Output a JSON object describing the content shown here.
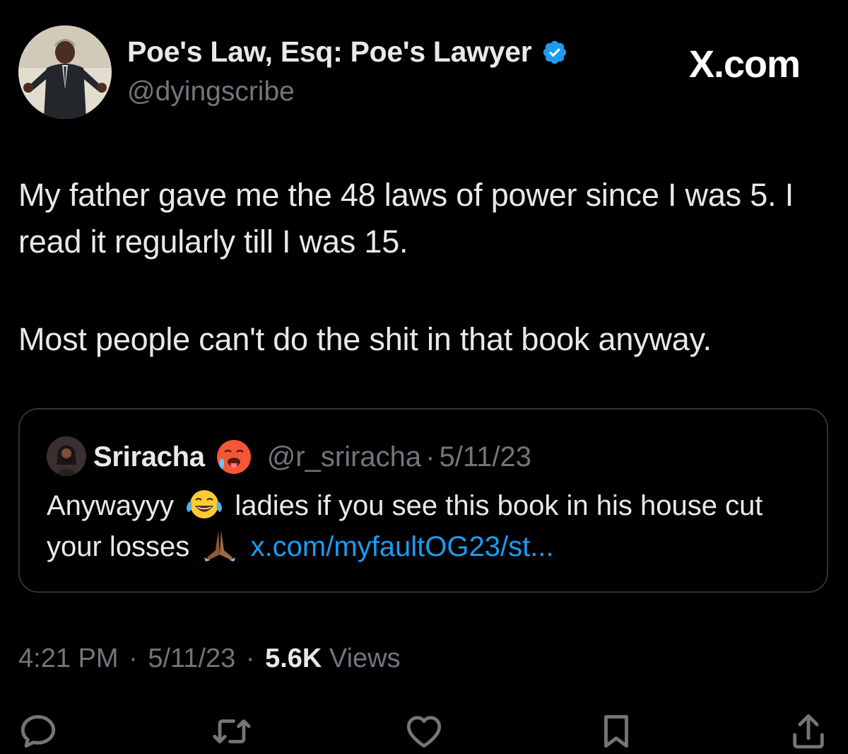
{
  "author": {
    "display_name": "Poe's Law, Esq: Poe's Lawyer",
    "handle": "@dyingscribe",
    "verified": true
  },
  "watermark": "X.com",
  "tweet": {
    "paragraphs": [
      "My father gave me the 48 laws of power since I was 5. I read it regularly till I was 15.",
      "Most people can't do the shit in that book anyway."
    ]
  },
  "quoted_tweet": {
    "display_name": "Sriracha",
    "name_emoji": "hot-face-icon",
    "handle": "@r_sriracha",
    "separator": "·",
    "date": "5/11/23",
    "text_part1": "Anywayyy",
    "text_part2": "ladies if you see this book in his house cut your losses",
    "link": "x.com/myfaultOG23/st..."
  },
  "meta": {
    "time": "4:21 PM",
    "separator": "·",
    "date": "5/11/23",
    "views_count": "5.6K",
    "views_label": "Views"
  },
  "actions": [
    {
      "name": "reply-icon"
    },
    {
      "name": "retweet-icon"
    },
    {
      "name": "like-icon"
    },
    {
      "name": "bookmark-icon"
    },
    {
      "name": "share-icon"
    }
  ],
  "colors": {
    "background": "#000000",
    "text": "#e7e9ea",
    "secondary": "#71767b",
    "link": "#1d9bf0",
    "verified": "#1d9bf0",
    "border": "#2f3336"
  }
}
